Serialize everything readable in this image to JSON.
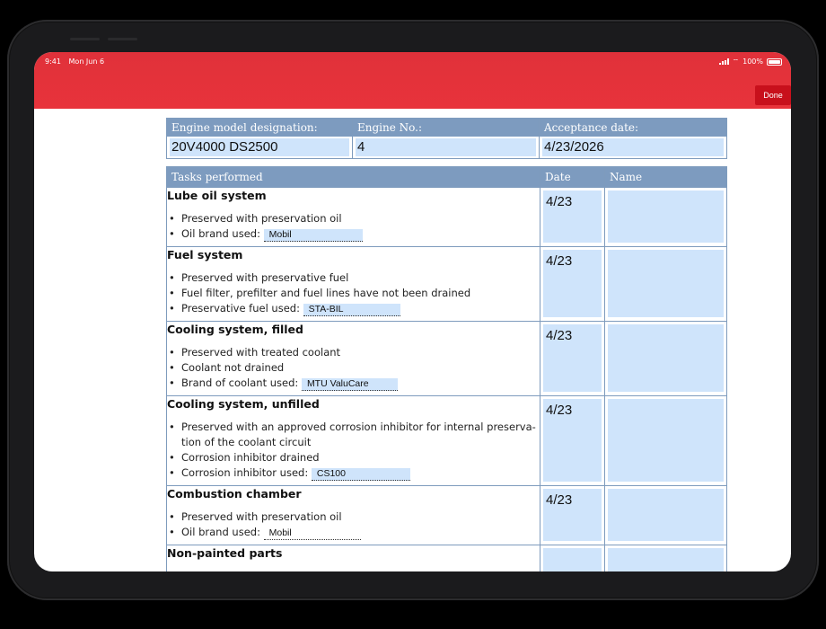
{
  "status_bar": {
    "time": "9:41",
    "date": "Mon Jun 6",
    "battery": "100%"
  },
  "toolbar": {
    "done_label": "Done"
  },
  "header": {
    "model_label": "Engine model designation:",
    "model_value": "20V4000 DS2500",
    "engine_no_label": "Engine No.:",
    "engine_no_value": "4",
    "acceptance_label": "Acceptance date:",
    "acceptance_value": "4/23/2026"
  },
  "tasks_table": {
    "col_tasks": "Tasks performed",
    "col_date": "Date",
    "col_name": "Name",
    "rows": [
      {
        "title": "Lube oil system",
        "items": [
          "Preserved with preservation oil",
          "Oil brand used: "
        ],
        "field_value": "Mobil",
        "date": "4/23",
        "name": ""
      },
      {
        "title": "Fuel system",
        "items": [
          "Preserved with preservative fuel",
          "Fuel filter, prefilter and fuel lines have not been drained",
          "Preservative fuel used: "
        ],
        "field_value": "STA-BIL",
        "date": "4/23",
        "name": ""
      },
      {
        "title": "Cooling system, filled",
        "items": [
          "Preserved with treated coolant",
          "Coolant not drained",
          "Brand of coolant used: "
        ],
        "field_value": "MTU ValuCare",
        "date": "4/23",
        "name": ""
      },
      {
        "title": "Cooling system, unfilled",
        "items": [
          "Preserved with an approved corrosion inhibitor for internal preserva-tion of the coolant circuit",
          "Corrosion inhibitor drained",
          "Corrosion inhibitor used: "
        ],
        "field_value": "CS100",
        "date": "4/23",
        "name": ""
      },
      {
        "title": "Combustion chamber",
        "items": [
          "Preserved with preservation oil",
          "Oil brand used: "
        ],
        "field_value": "Mobil",
        "date": "4/23",
        "name": ""
      },
      {
        "title": "Non-painted parts",
        "items": [],
        "field_value": "",
        "date": "",
        "name": ""
      }
    ]
  },
  "colors": {
    "brand_red": "#e8333b",
    "done_red": "#c8101c",
    "header_blue": "#7d9bbf",
    "field_blue": "#cfe4fb"
  }
}
